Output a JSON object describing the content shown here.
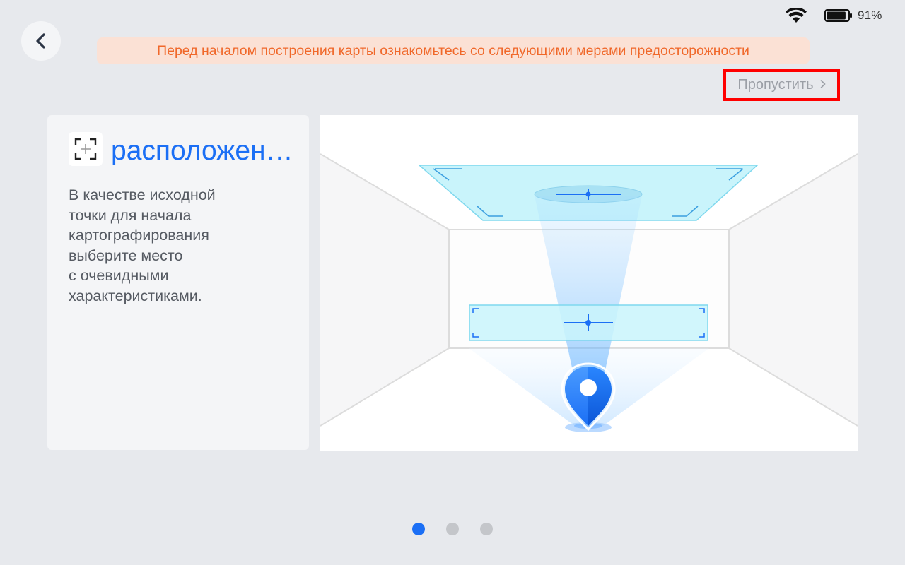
{
  "status_bar": {
    "battery_percent": "91%",
    "wifi_icon": "wifi-icon",
    "battery_icon": "battery-icon",
    "battery_level": 0.91
  },
  "header": {
    "back_icon": "chevron-left-icon",
    "warning_text": "Перед началом построения карты ознакомьтесь со следующими мерами предосторожности",
    "skip_label": "Пропустить",
    "skip_icon": "chevron-right-icon"
  },
  "card": {
    "icon": "focus-crosshair-icon",
    "title": "расположение",
    "description": "В качестве исходной\nточки для начала\nкартографирования\nвыберите место\nс очевидными\nхарактеристиками."
  },
  "illustration": {
    "name": "room-location-illustration"
  },
  "pagination": {
    "pages": 3,
    "active": 0
  },
  "colors": {
    "accent": "#1b6ff5",
    "warning_text": "#f0682a",
    "warning_bg": "#fbe1d5",
    "background": "#e7e9ed",
    "highlight_border": "#ff0000"
  }
}
